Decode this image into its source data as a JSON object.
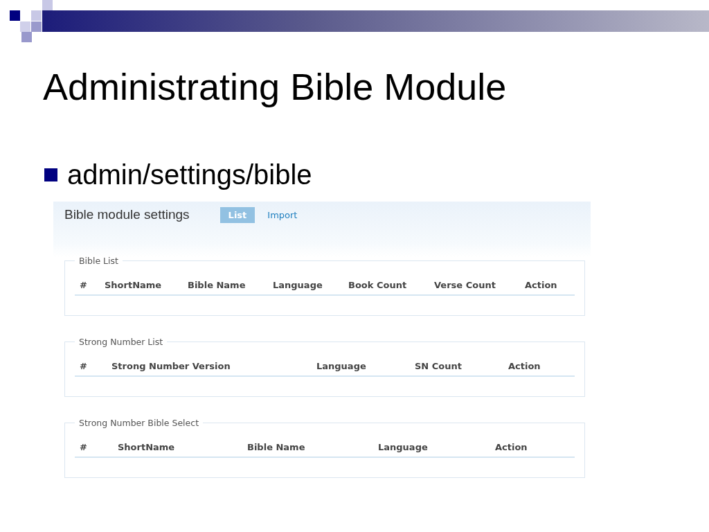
{
  "slide": {
    "title": "Administrating Bible Module",
    "bullet": "admin/settings/bible"
  },
  "screen": {
    "title": "Bible module settings",
    "tabs": [
      {
        "label": "List",
        "selected": true
      },
      {
        "label": "Import",
        "selected": false
      }
    ],
    "sections": [
      {
        "legend": "Bible List",
        "columns": [
          "#",
          "ShortName",
          "Bible Name",
          "Language",
          "Book Count",
          "Verse Count",
          "Action"
        ]
      },
      {
        "legend": "Strong Number List",
        "columns": [
          "#",
          "Strong Number Version",
          "Language",
          "SN Count",
          "Action"
        ]
      },
      {
        "legend": "Strong Number Bible Select",
        "columns": [
          "#",
          "ShortName",
          "Bible Name",
          "Language",
          "Action"
        ]
      }
    ]
  }
}
